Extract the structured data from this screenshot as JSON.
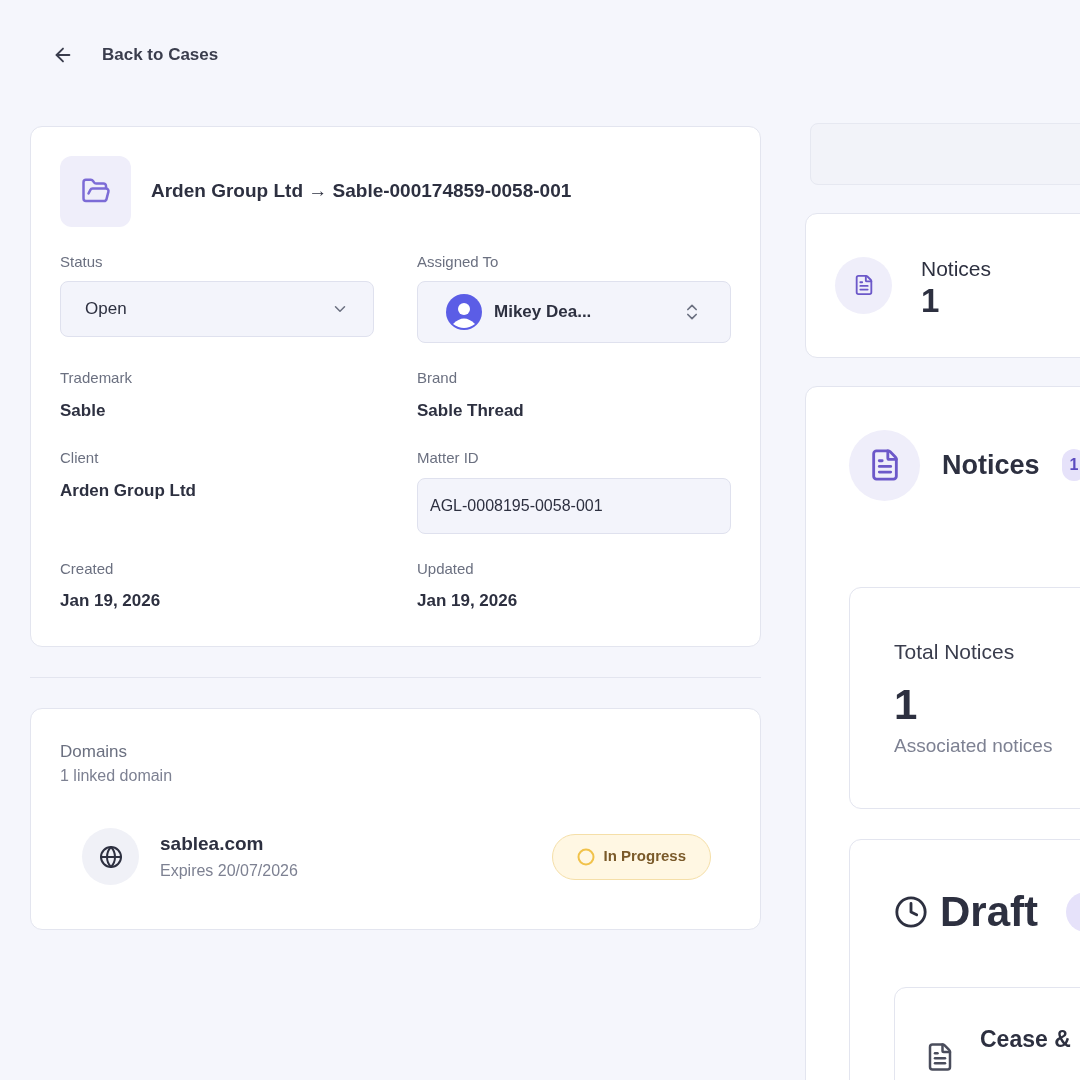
{
  "back_link": "Back to Cases",
  "case": {
    "title": "Arden Group Ltd → Sable-000174859-0058-001",
    "status": {
      "label": "Status",
      "value": "Open"
    },
    "assigned": {
      "label": "Assigned To",
      "value": "Mikey Dea..."
    },
    "fields": [
      {
        "label": "Trademark",
        "value": "Sable",
        "kind": "text"
      },
      {
        "label": "Brand",
        "value": "Sable Thread",
        "kind": "text"
      },
      {
        "label": "Client",
        "value": "Arden Group Ltd",
        "kind": "text"
      },
      {
        "label": "Matter ID",
        "value": "AGL-0008195-0058-001",
        "kind": "input"
      },
      {
        "label": "Created",
        "value": "Jan 19, 2026",
        "kind": "text"
      },
      {
        "label": "Updated",
        "value": "Jan 19, 2026",
        "kind": "text"
      }
    ]
  },
  "domains": {
    "title": "Domains",
    "subtitle": "1 linked domain",
    "items": [
      {
        "name": "sablea.com",
        "expires": "Expires 20/07/2026",
        "status": "In Progress"
      }
    ]
  },
  "stat_card": {
    "label": "Notices",
    "value": "1"
  },
  "notices_panel": {
    "title": "Notices",
    "badge": "1",
    "total": {
      "label": "Total Notices",
      "value": "1",
      "caption": "Associated notices"
    },
    "group": {
      "title": "Draft",
      "items": [
        {
          "title": "Cease &"
        }
      ]
    }
  }
}
